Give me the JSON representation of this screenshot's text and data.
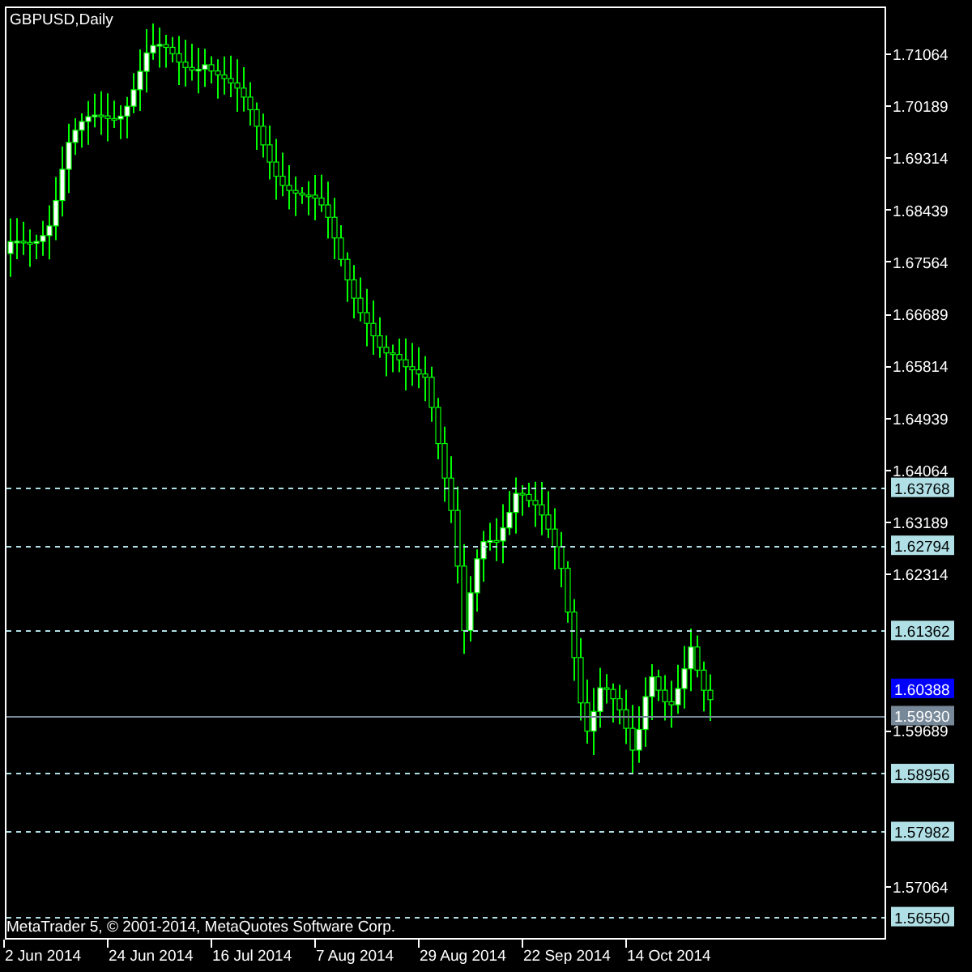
{
  "chart": {
    "title": "GBPUSD,Daily",
    "price_axis": [
      "1.71064",
      "1.70189",
      "1.69314",
      "1.68439",
      "1.67564",
      "1.66689",
      "1.65814",
      "1.64939",
      "1.64064",
      "1.63189",
      "1.62314",
      "1.59689",
      "1.57064"
    ],
    "levels": [
      {
        "price": "1.63768",
        "kind": "dashed"
      },
      {
        "price": "1.62794",
        "kind": "dashed"
      },
      {
        "price": "1.61362",
        "kind": "dashed"
      },
      {
        "price": "1.60388",
        "kind": "ask"
      },
      {
        "price": "1.59930",
        "kind": "bid"
      },
      {
        "price": "1.58956",
        "kind": "dashed"
      },
      {
        "price": "1.57982",
        "kind": "dashed"
      },
      {
        "price": "1.56550",
        "kind": "dashed"
      }
    ],
    "time_axis": [
      "2 Jun 2014",
      "24 Jun 2014",
      "16 Jul 2014",
      "7 Aug 2014",
      "29 Aug 2014",
      "22 Sep 2014",
      "14 Oct 2014"
    ],
    "footer": "MetaTrader 5, © 2001-2014, MetaQuotes Software Corp."
  }
}
